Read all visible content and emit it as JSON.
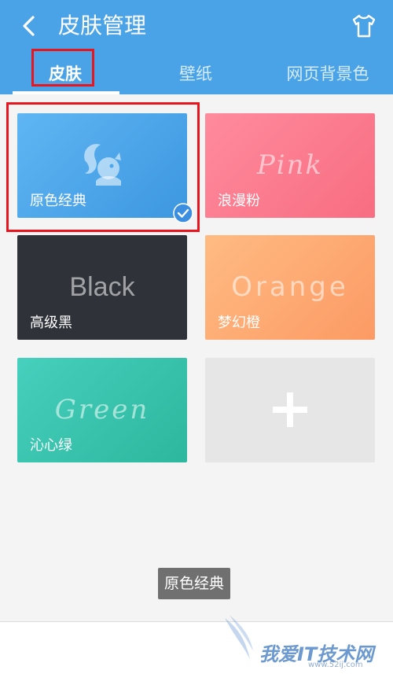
{
  "header": {
    "title": "皮肤管理",
    "tabs": [
      {
        "label": "皮肤",
        "active": true
      },
      {
        "label": "壁纸",
        "active": false
      },
      {
        "label": "网页背景色",
        "active": false
      }
    ]
  },
  "skins": [
    {
      "label": "原色经典",
      "wordmark": "",
      "selected": true,
      "color": "#4aa7ee"
    },
    {
      "label": "浪漫粉",
      "wordmark": "Pink",
      "selected": false,
      "color": "#fb7b8d"
    },
    {
      "label": "高级黑",
      "wordmark": "Black",
      "selected": false,
      "color": "#2f3238"
    },
    {
      "label": "梦幻橙",
      "wordmark": "Orange",
      "selected": false,
      "color": "#fdaa72"
    },
    {
      "label": "沁心绿",
      "wordmark": "Green",
      "selected": false,
      "color": "#3bc3ad"
    }
  ],
  "toast": {
    "text": "原色经典"
  },
  "watermark": {
    "text": "我爱IT技术网",
    "url": "www.52ij.com"
  },
  "colors": {
    "header": "#4aa3e6",
    "highlight": "#e8141e",
    "check": "#3c8fe0"
  },
  "icons": {
    "back": "chevron-left-icon",
    "skin": "tshirt-icon",
    "add": "plus-icon",
    "selected": "check-icon",
    "logo": "squirrel-icon"
  }
}
